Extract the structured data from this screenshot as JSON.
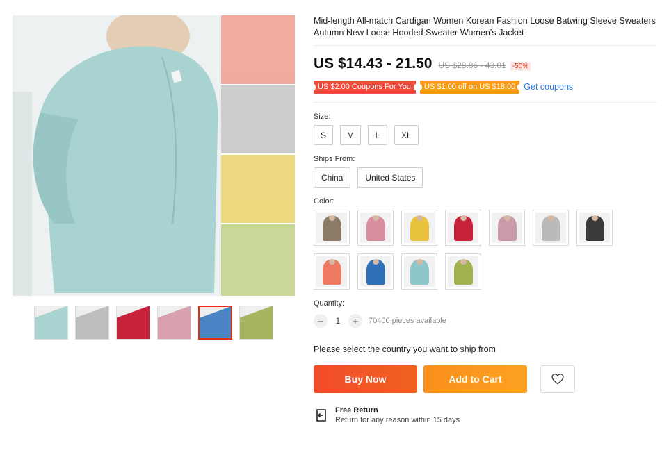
{
  "product": {
    "title": "Mid-length All-match Cardigan Women Korean Fashion Loose Batwing Sleeve Sweaters Autumn New Loose Hooded Sweater Women's Jacket",
    "price": "US $14.43 - 21.50",
    "original_price": "US $28.86 - 43.01",
    "discount": "-50%"
  },
  "coupons": {
    "store_coupon": "US $2.00 Coupons For You",
    "order_coupon": "US $1.00 off on US $18.00",
    "get_coupons": "Get coupons"
  },
  "size": {
    "label": "Size:",
    "options": [
      "S",
      "M",
      "L",
      "XL"
    ]
  },
  "ships_from": {
    "label": "Ships From:",
    "options": [
      "China",
      "United States"
    ]
  },
  "color": {
    "label": "Color:",
    "swatches": [
      "#8a7a66",
      "#d98ea0",
      "#e8c23c",
      "#c8223a",
      "#c99aa8",
      "#b9b9b9",
      "#3a3a3a",
      "#ee7a62",
      "#2f6fb8",
      "#8ec7c9",
      "#9fb24e"
    ]
  },
  "gallery": {
    "main_color": "#a9d3d1",
    "side_colors": [
      "#f0a08e",
      "#c6c6c6",
      "#ecd36a",
      "#c3d48a"
    ],
    "thumb_colors": [
      "#a9d3d1",
      "#bdbdbd",
      "#c8223a",
      "#d9a0ae",
      "#4a84c4",
      "#a7b561"
    ],
    "active_thumb": 4
  },
  "quantity": {
    "label": "Quantity:",
    "value": "1",
    "minus": "−",
    "plus": "+",
    "available": "70400 pieces available"
  },
  "ship_note": "Please select the country you want to ship from",
  "actions": {
    "buy_now": "Buy Now",
    "add_to_cart": "Add to Cart"
  },
  "return_policy": {
    "title": "Free Return",
    "subtitle": "Return for any reason within 15 days"
  }
}
